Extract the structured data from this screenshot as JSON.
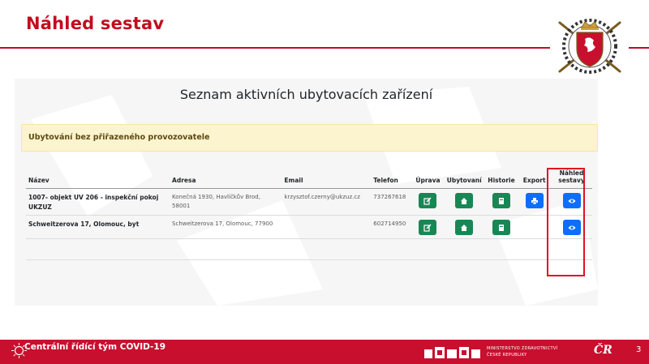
{
  "slide": {
    "title": "Náhled sestav",
    "page_number": "3"
  },
  "app": {
    "heading": "Seznam aktivních ubytovacích zařízení",
    "alert_text": "Ubytování bez přiřazeného provozovatele",
    "table": {
      "headers": {
        "name": "Název",
        "address": "Adresa",
        "email": "Email",
        "phone": "Telefon",
        "edit": "Úprava",
        "accommodation": "Ubytovaní",
        "history": "Historie",
        "export": "Export",
        "preview_line1": "Náhled",
        "preview_line2": "sestavy"
      },
      "rows": [
        {
          "name": "1007- objekt UV 206 - inspekční pokoj UKZUZ",
          "address": "Konečná 1930, Havlíčkův Brod, 58001",
          "email": "krzysztof.czerny@ukzuz.cz",
          "phone": "737267618"
        },
        {
          "name": "Schweitzerova 17, Olomouc, byt",
          "address": "Schweitzerova 17, Olomouc, 77900",
          "email": "",
          "phone": "602714950"
        }
      ]
    }
  },
  "footer": {
    "team": "Centrální řídící tým COVID-19",
    "ministry_line1": "Ministerstvo zdravotnictví",
    "ministry_line2": "České republiky",
    "cr_mark": "ČR"
  },
  "colors": {
    "brand_red": "#c8102e",
    "title_red": "#c00d1e",
    "button_green": "#198754",
    "button_blue": "#0d6efd",
    "alert_bg": "#fcf3cf",
    "highlight_red": "#e0121f"
  },
  "icons": {
    "edit": "edit-icon",
    "accommodation": "home-icon",
    "history": "book-icon",
    "export": "print-icon",
    "preview": "eye-icon"
  }
}
